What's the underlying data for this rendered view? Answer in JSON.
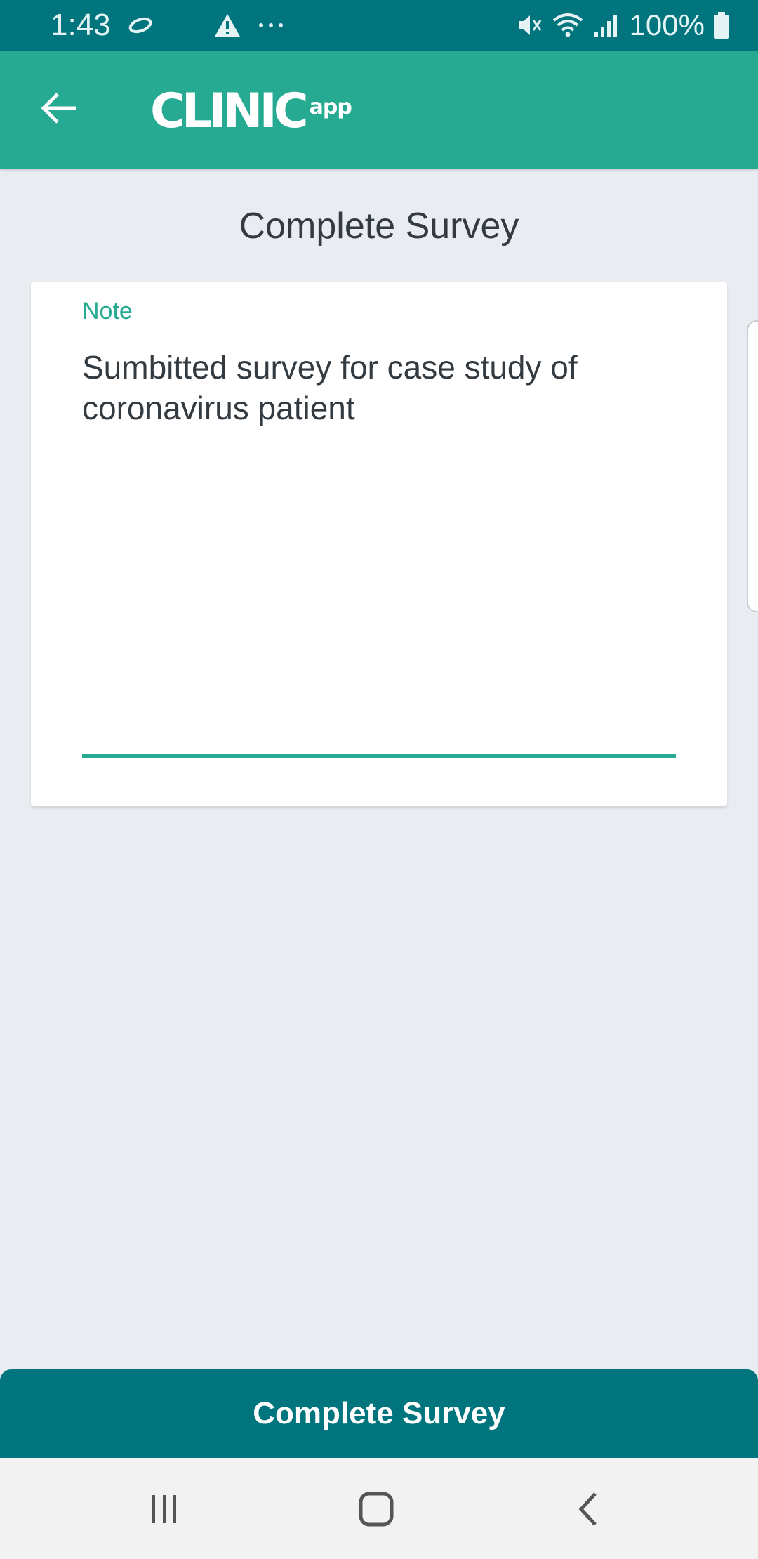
{
  "status_bar": {
    "time": "1:43",
    "battery_text": "100%",
    "icons": [
      "sync-icon",
      "warning-icon",
      "more-dots-icon",
      "mute-icon",
      "wifi-icon",
      "signal-icon",
      "battery-icon"
    ]
  },
  "app_bar": {
    "logo_main": "CLINIC",
    "logo_suffix": "app",
    "back_icon": "arrow-left-icon"
  },
  "page": {
    "title": "Complete Survey"
  },
  "form": {
    "note_label": "Note",
    "note_value": "Sumbitted survey for case study of coronavirus patient"
  },
  "actions": {
    "complete_label": "Complete Survey"
  },
  "nav_bar": {
    "icons": [
      "recent-apps-icon",
      "home-icon",
      "back-icon"
    ]
  },
  "colors": {
    "status_bar": "#00757d",
    "app_bar": "#26aa92",
    "accent": "#26aa92",
    "button": "#00757d",
    "background": "#e9ecf1"
  }
}
